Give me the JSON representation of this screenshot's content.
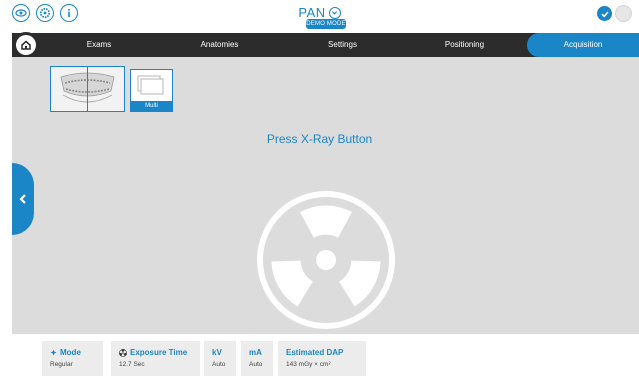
{
  "header": {
    "title": "PAN",
    "badge": "DEMO MODE",
    "left_icons": [
      "eye-icon",
      "settings-icon",
      "info-icon"
    ],
    "right_icons": [
      "check-icon",
      "status-icon"
    ]
  },
  "nav": {
    "tabs": [
      {
        "label": "Exams"
      },
      {
        "label": "Anatomies"
      },
      {
        "label": "Settings"
      },
      {
        "label": "Positioning"
      },
      {
        "label": "Acquisition",
        "active": true
      }
    ]
  },
  "main": {
    "multi_label": "Multi",
    "prompt": "Press X-Ray Button"
  },
  "params": [
    {
      "label": "Mode",
      "value": "Regular",
      "icon": "mode-icon"
    },
    {
      "label": "Exposure Time",
      "value": "12.7 Sec",
      "icon": "radiation-icon"
    },
    {
      "label": "kV",
      "value": "Auto"
    },
    {
      "label": "mA",
      "value": "Auto"
    },
    {
      "label": "Estimated DAP",
      "value": "143 mGy × cm²"
    }
  ],
  "colors": {
    "accent": "#1a86c8",
    "navbar": "#2c2c2c",
    "workspace": "#dcdcdc"
  }
}
